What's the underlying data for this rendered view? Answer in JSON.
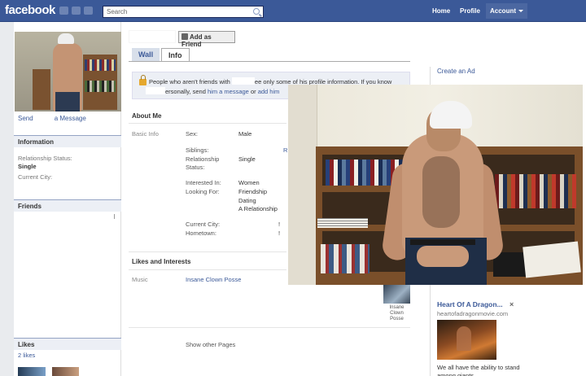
{
  "header": {
    "logo": "facebook",
    "search_placeholder": "Search",
    "nav": {
      "home": "Home",
      "profile": "Profile",
      "account": "Account"
    }
  },
  "sidebar": {
    "send_message": {
      "send": "Send",
      "message": "a Message"
    },
    "information": {
      "title": "Information",
      "relationship_label": "Relationship Status:",
      "relationship_value": "Single",
      "current_city_label": "Current City:"
    },
    "friends_title": "Friends",
    "likes": {
      "title": "Likes",
      "count": "2 likes"
    }
  },
  "profile": {
    "add_friend_label": "Add as Friend",
    "tabs": [
      {
        "label": "Wall"
      },
      {
        "label": "Info"
      }
    ],
    "notice": {
      "part1": "People who aren't friends with",
      "part2": "ee only some of his profile information. If you know",
      "part3": "ersonally, send",
      "message_link": "him a message",
      "part4": "or",
      "add_link": "add him"
    },
    "about": {
      "title": "About Me",
      "basic_info_label": "Basic Info",
      "sex_label": "Sex:",
      "sex_value": "Male",
      "siblings_label": "Siblings:",
      "siblings_value_fragment": "R",
      "relationship_label_1": "Relationship",
      "relationship_label_2": "Status:",
      "relationship_value": "Single",
      "interested_label": "Interested In:",
      "interested_value": "Women",
      "looking_label": "Looking For:",
      "looking_values": [
        "Friendship",
        "Dating",
        "A Relationship"
      ],
      "current_city_label": "Current City:",
      "hometown_label": "Hometown:",
      "city_fragment": "!",
      "hometown_fragment": "!"
    },
    "likes_interests": {
      "title": "Likes and Interests",
      "music_label": "Music",
      "music_value": "Insane Clown Posse",
      "thumb_label": [
        "Insane",
        "Clown",
        "Posse"
      ],
      "show_other": "Show other Pages"
    }
  },
  "right_column": {
    "create_ad": "Create an Ad",
    "ad": {
      "title": "Heart Of A Dragon...",
      "close_glyph": "×",
      "url": "heartofadragonmovie.com",
      "text": "We all have the ability to stand among giants"
    }
  },
  "colors": {
    "brand_blue": "#3b5998",
    "page_bg": "#e9ebee",
    "notice_bg": "#eceff5"
  }
}
